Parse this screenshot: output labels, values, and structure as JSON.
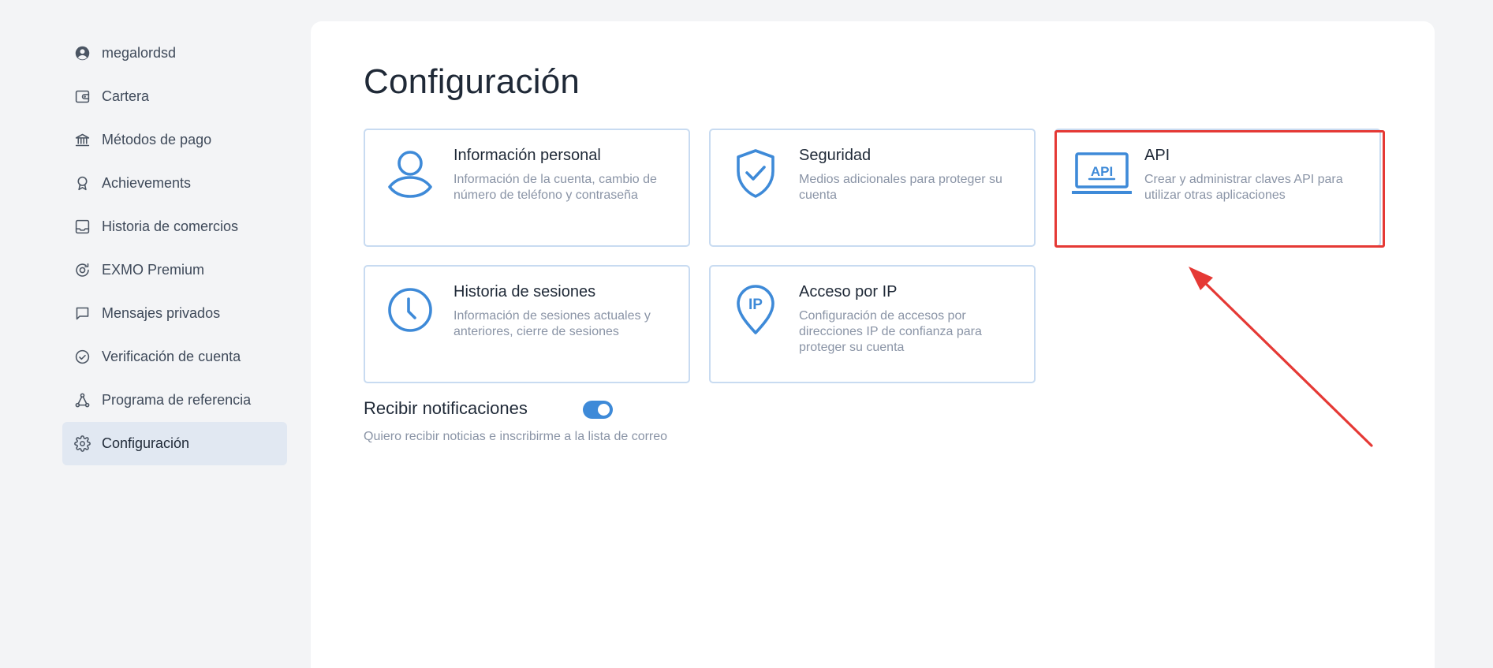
{
  "sidebar": {
    "items": [
      {
        "label": "megalordsd",
        "icon": "user-circle-icon"
      },
      {
        "label": "Cartera",
        "icon": "wallet-icon"
      },
      {
        "label": "Métodos de pago",
        "icon": "bank-icon"
      },
      {
        "label": "Achievements",
        "icon": "award-icon"
      },
      {
        "label": "Historia de comercios",
        "icon": "inbox-icon"
      },
      {
        "label": "EXMO Premium",
        "icon": "premium-icon"
      },
      {
        "label": "Mensajes privados",
        "icon": "message-icon"
      },
      {
        "label": "Verificación de cuenta",
        "icon": "check-circle-icon"
      },
      {
        "label": "Programa de referencia",
        "icon": "share-icon"
      },
      {
        "label": "Configuración",
        "icon": "gear-icon",
        "active": true
      }
    ]
  },
  "main": {
    "title": "Configuración",
    "cards": [
      {
        "title": "Información personal",
        "description": "Información de la cuenta, cambio de número de teléfono y contraseña",
        "icon": "person-icon"
      },
      {
        "title": "Seguridad",
        "description": "Medios adicionales para proteger su cuenta",
        "icon": "shield-check-icon"
      },
      {
        "title": "API",
        "description": "Crear y administrar claves API para utilizar otras aplicaciones",
        "icon": "api-laptop-icon",
        "icon_text": "API"
      },
      {
        "title": "Historia de sesiones",
        "description": "Información de sesiones actuales y anteriores, cierre de sesiones",
        "icon": "clock-icon"
      },
      {
        "title": "Acceso por IP",
        "description": "Configuración de accesos por direcciones IP de confianza para proteger su cuenta",
        "icon": "ip-pin-icon",
        "icon_text": "IP"
      }
    ],
    "notifications": {
      "title": "Recibir notificaciones",
      "description": "Quiero recibir noticias e inscribirme a la lista de correo",
      "enabled": true
    }
  },
  "colors": {
    "accent": "#3e8ad8",
    "annotation": "#e53935",
    "card_border": "#c8dbf1",
    "active_nav": "#e1e8f2"
  }
}
